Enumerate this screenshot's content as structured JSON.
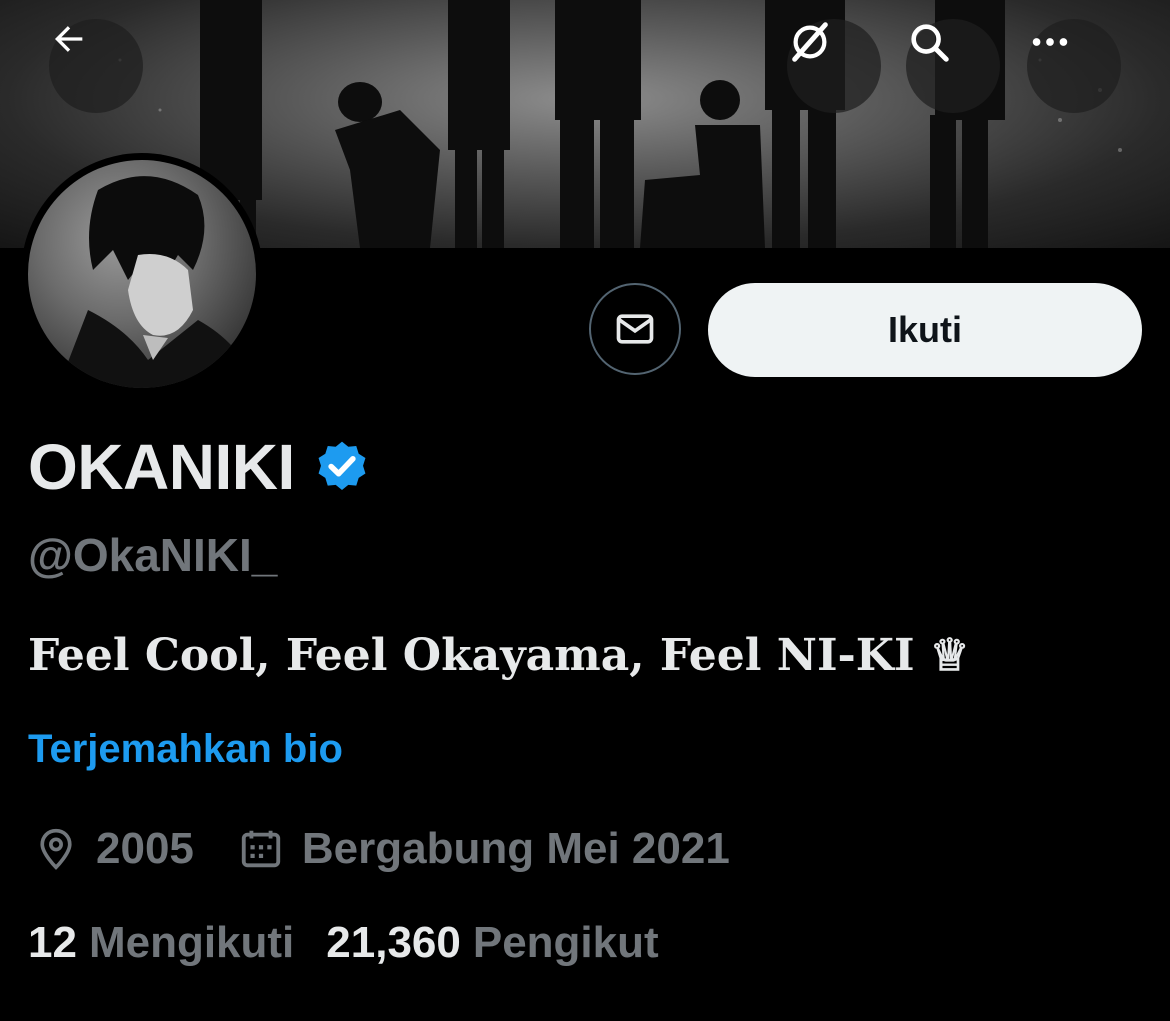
{
  "header": {
    "back_icon": "arrow-left-icon",
    "grok_icon": "grok-icon",
    "search_icon": "search-icon",
    "more_icon": "more-horizontal-icon"
  },
  "actions": {
    "message_icon": "envelope-icon",
    "follow_label": "Ikuti"
  },
  "profile": {
    "display_name": "OKANIKI",
    "handle": "@OkaNIKI_",
    "bio": "Feel Cool, Feel Okayama, Feel NI-KI ♕",
    "translate_bio": "Terjemahkan bio",
    "location": "2005",
    "joined": "Bergabung Mei 2021",
    "following_count": "12",
    "following_label": "Mengikuti",
    "followers_count": "21,360",
    "followers_label": "Pengikut"
  },
  "colors": {
    "background": "#000000",
    "accent": "#1d9bf0",
    "muted": "#71767b",
    "text": "#e7e9ea"
  }
}
